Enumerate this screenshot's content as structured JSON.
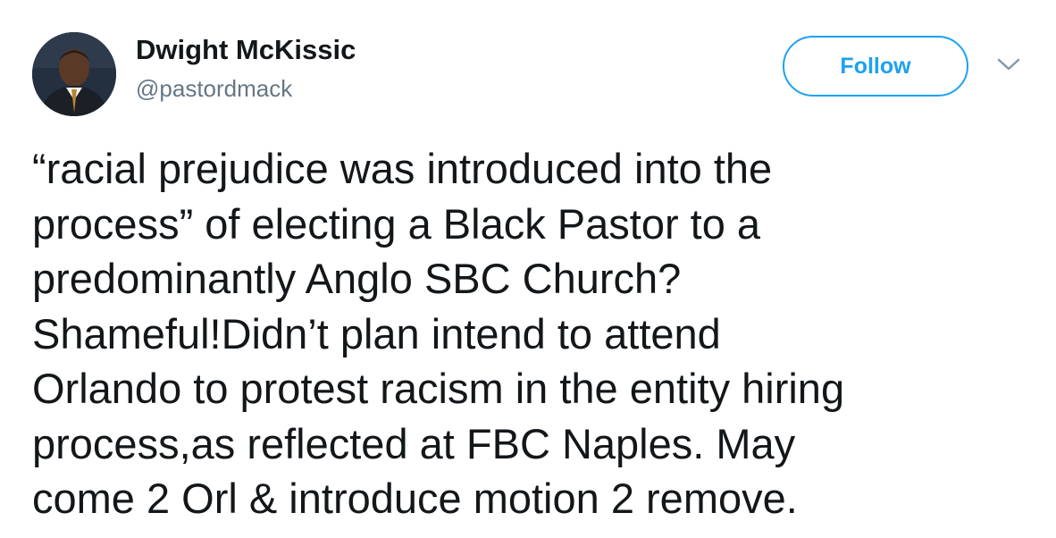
{
  "user": {
    "display_name": "Dwight McKissic",
    "handle": "@pastordmack",
    "avatar": "profile-photo"
  },
  "actions": {
    "follow_label": "Follow",
    "more_icon": "chevron-down-icon"
  },
  "colors": {
    "accent": "#1da1f2",
    "text_primary": "#14171a",
    "text_secondary": "#657786",
    "chevron": "#8899a6"
  },
  "tweet": {
    "lines": [
      "“racial prejudice was introduced into the",
      "process” of electing a Black Pastor to a",
      "predominantly Anglo SBC Church?",
      "Shameful!Didn’t plan intend to attend",
      "Orlando to protest racism in the entity hiring",
      "process,as reflected at FBC Naples. May",
      "come 2 Orl & introduce motion 2 remove."
    ]
  }
}
